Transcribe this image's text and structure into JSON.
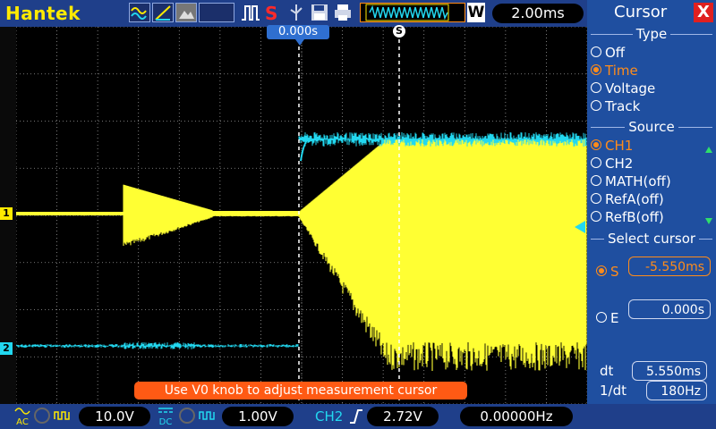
{
  "header": {
    "brand": "Hantek",
    "timebase": "2.00ms",
    "wave_mode_label": "W",
    "trigger_stop_label": "S",
    "icons": [
      "wave-icon",
      "ramp-icon",
      "image-icon",
      "pulse-icon",
      "stop-icon",
      "save-icon",
      "print-icon"
    ]
  },
  "scope": {
    "trigger_position": "0.000s",
    "cursor_marker": "S",
    "ch1_label": "1",
    "ch2_label": "2",
    "message": "Use V0 knob to adjust measurement cursor",
    "colors": {
      "ch1": "#ffff33",
      "ch2": "#22d8f0",
      "grid": "#9a9a9a",
      "cursor": "#ffffff"
    }
  },
  "side": {
    "title": "Cursor",
    "close": "X",
    "type_title": "Type",
    "type_options": [
      "Off",
      "Time",
      "Voltage",
      "Track"
    ],
    "type_selected": "Time",
    "source_title": "Source",
    "source_options": [
      "CH1",
      "CH2",
      "MATH(off)",
      "RefA(off)",
      "RefB(off)"
    ],
    "source_selected": "CH1",
    "select_title": "Select cursor",
    "s_label": "S",
    "s_value": "-5.550ms",
    "e_label": "E",
    "e_value": "0.000s",
    "dt_label": "dt",
    "dt_value": "5.550ms",
    "inv_dt_label": "1/dt",
    "inv_dt_value": "180Hz"
  },
  "bottom": {
    "ch1_coupling": "AC",
    "ch1_scale": "10.0V",
    "ch2_coupling": "DC",
    "ch2_scale": "1.00V",
    "trig_source": "CH2",
    "trig_level": "2.72V",
    "frequency": "0.00000Hz"
  }
}
